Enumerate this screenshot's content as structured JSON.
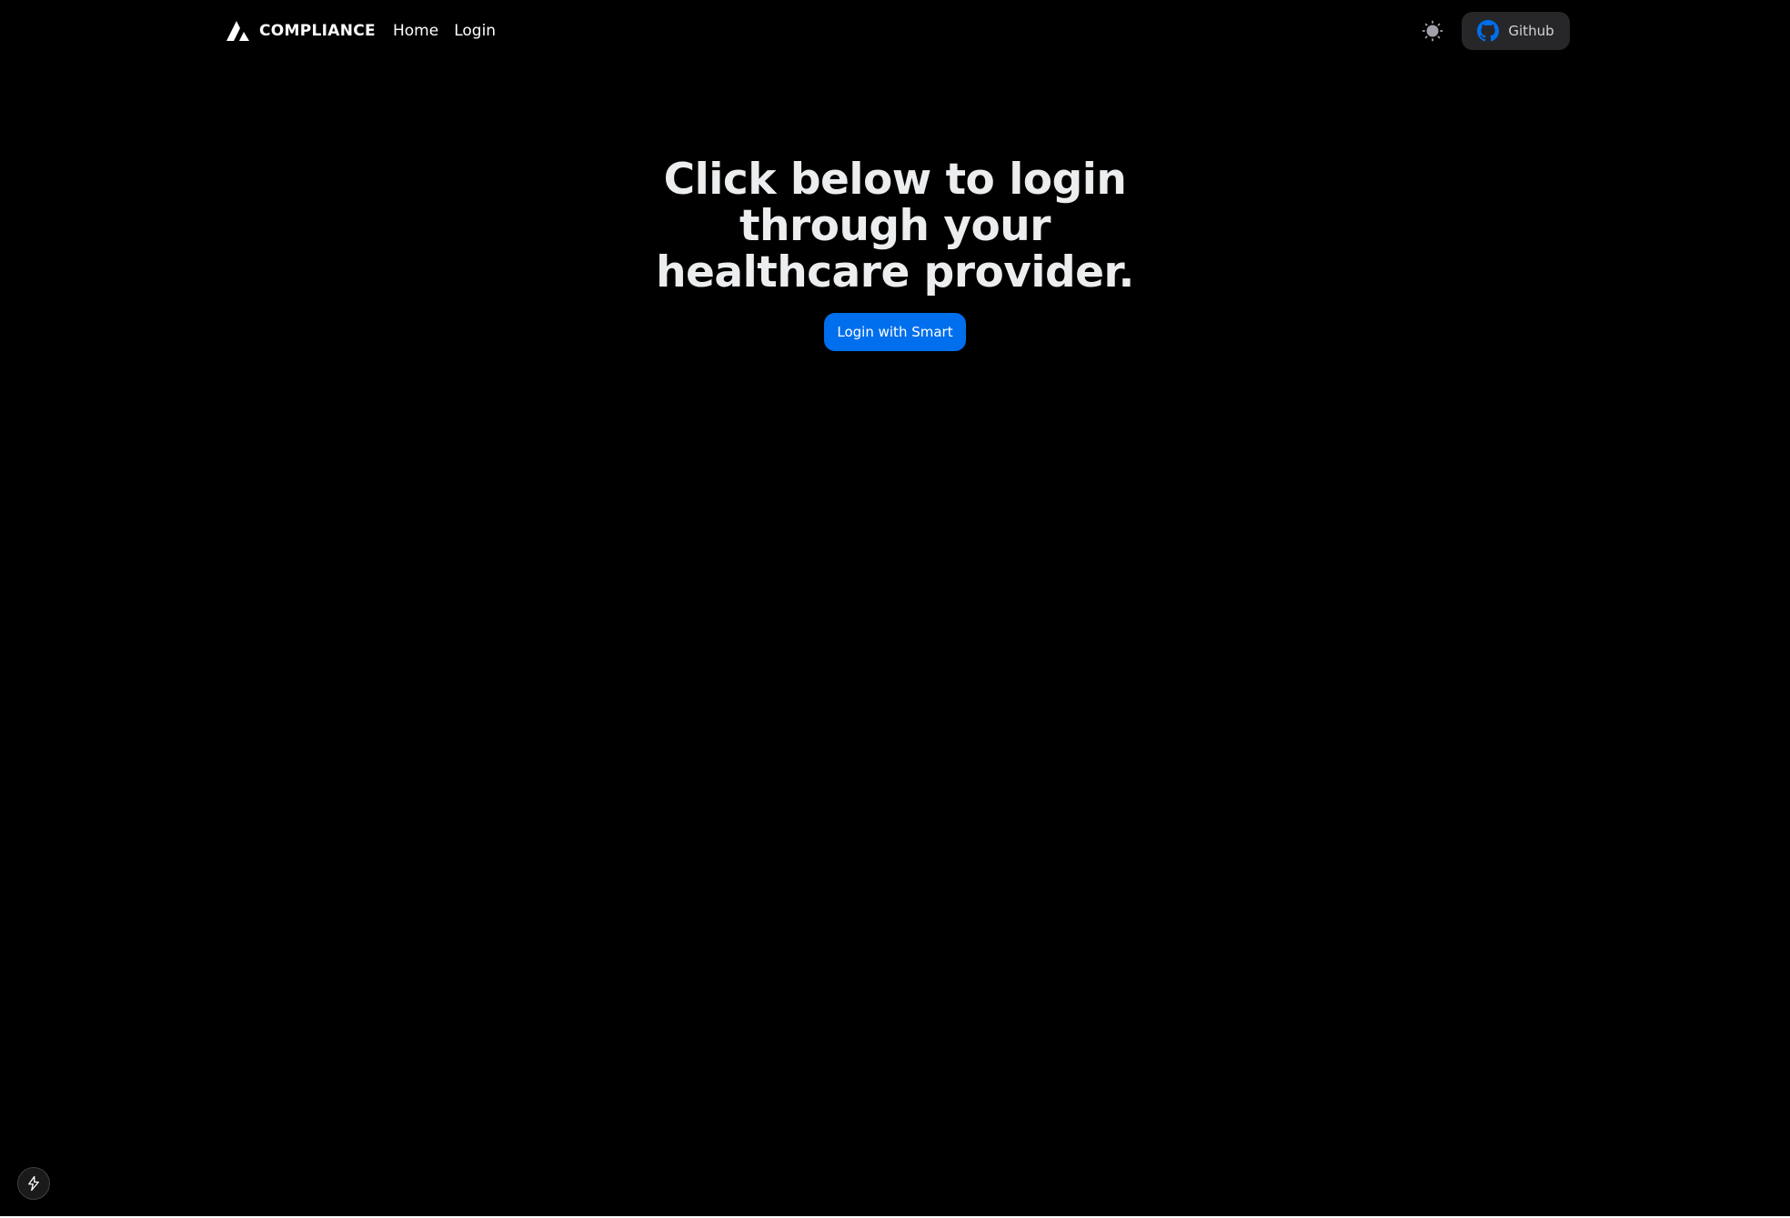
{
  "header": {
    "brand_name": "COMPLIANCE",
    "logo_icon": "triangle-logo-icon",
    "nav": [
      {
        "label": "Home"
      },
      {
        "label": "Login"
      }
    ],
    "theme_toggle_icon": "sun-icon",
    "github": {
      "icon": "github-icon",
      "label": "Github",
      "icon_color": "#006FEE"
    }
  },
  "main": {
    "title": "Click below to login through your healthcare provider.",
    "login_button_label": "Login with Smart",
    "accent_color": "#006FEE"
  },
  "dev_indicator": {
    "icon": "nextjs-lightning-icon"
  }
}
